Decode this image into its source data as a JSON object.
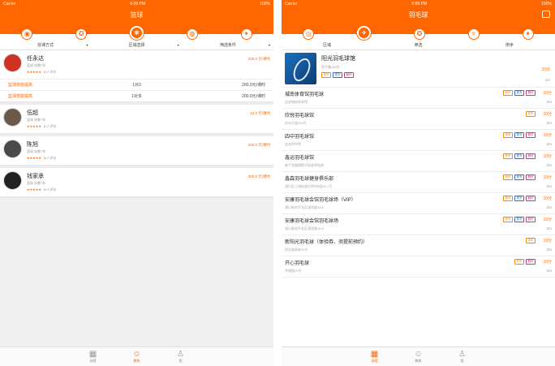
{
  "left": {
    "status": {
      "carrier": "Carrier",
      "time": "6:09 PM",
      "battery": "100%"
    },
    "title": "篮球",
    "categories": [
      {
        "icon": "whistle-icon",
        "glyph": "◉",
        "active": false
      },
      {
        "icon": "soccer-icon",
        "glyph": "✪",
        "active": false
      },
      {
        "icon": "basketball-icon",
        "glyph": "❋",
        "active": true
      },
      {
        "icon": "volleyball-icon",
        "glyph": "◍",
        "active": false
      },
      {
        "icon": "runner-icon",
        "glyph": "✦",
        "active": false
      }
    ],
    "filters": [
      "授课方式",
      "区域选择",
      "筛选条件"
    ],
    "coaches": [
      {
        "name": "任永达",
        "sub": "篮球 执教7年",
        "stars": "★★★★★",
        "reviews": "10人评价",
        "price": "200.0 元/课时",
        "avatar_color": "#cc3322",
        "courses": [
          {
            "name": "篮球技能提高",
            "type": "1对3",
            "price": "200.0元/课时"
          },
          {
            "name": "篮球技能提高",
            "type": "1对多",
            "price": "200.0元/课时"
          }
        ]
      },
      {
        "name": "伍超",
        "sub": "篮球 执教7年",
        "stars": "★★★★★",
        "reviews": "10人评价",
        "price": "10.0 元/课时",
        "avatar_color": "#6b5a4a",
        "courses": []
      },
      {
        "name": "陈旭",
        "sub": "篮球 执教7年",
        "stars": "★★★★★",
        "reviews": "10人评价",
        "price": "200.0 元/课时",
        "avatar_color": "#4a4a4a",
        "courses": []
      },
      {
        "name": "钱家承",
        "sub": "篮球 执教7年",
        "stars": "★★★★★",
        "reviews": "10人评价",
        "price": "300.0 元/课时",
        "avatar_color": "#222222",
        "courses": []
      }
    ],
    "tabs": [
      {
        "label": "场馆",
        "icon": "grid-icon",
        "glyph": "▦",
        "active": false
      },
      {
        "label": "教练",
        "icon": "users-icon",
        "glyph": "☺",
        "active": true
      },
      {
        "label": "我",
        "icon": "person-icon",
        "glyph": "♙",
        "active": false
      }
    ]
  },
  "right": {
    "status": {
      "carrier": "Carrier",
      "time": "6:09 PM",
      "battery": "100%"
    },
    "title": "羽毛球",
    "categories": [
      {
        "icon": "target-icon",
        "glyph": "◎",
        "active": false
      },
      {
        "icon": "badminton-icon",
        "glyph": "✈",
        "active": true
      },
      {
        "icon": "soccer-icon",
        "glyph": "✪",
        "active": false
      },
      {
        "icon": "swimming-icon",
        "glyph": "≈",
        "active": false
      },
      {
        "icon": "runner-icon",
        "glyph": "✦",
        "active": false
      }
    ],
    "filters": [
      "区域",
      "筛选",
      "排序"
    ],
    "featured": {
      "name": "阳光羽毛球馆",
      "addr": "华宁路190号",
      "tags": [
        {
          "text": "停车",
          "cls": "t-or"
        },
        {
          "text": "更衣",
          "cls": "t-bl"
        },
        {
          "text": "器材",
          "cls": "t-pk"
        }
      ],
      "score": "10分",
      "dist": "1m"
    },
    "venues": [
      {
        "name": "城南体育馆羽毛球",
        "addr": "连安城南体育馆",
        "tags": [
          {
            "text": "停车",
            "cls": "t-or"
          },
          {
            "text": "更衣",
            "cls": "t-bl"
          },
          {
            "text": "器材",
            "cls": "t-pk"
          }
        ],
        "score": "10分",
        "dist": "2m"
      },
      {
        "name": "欣悦羽毛球馆",
        "addr": "苏州大道259号",
        "tags": [
          {
            "text": "停车",
            "cls": "t-or"
          }
        ],
        "score": "10分",
        "dist": "2m"
      },
      {
        "name": "四中羽毛球馆",
        "addr": "连安四中馆",
        "tags": [
          {
            "text": "停车",
            "cls": "t-or"
          },
          {
            "text": "更衣",
            "cls": "t-bl"
          },
          {
            "text": "器材",
            "cls": "t-pk"
          }
        ],
        "score": "10分",
        "dist": "2m"
      },
      {
        "name": "鑫运羽毛球馆",
        "addr": "新千里路隔壁对面老师电商",
        "tags": [
          {
            "text": "停车",
            "cls": "t-or"
          },
          {
            "text": "更衣",
            "cls": "t-bl"
          },
          {
            "text": "器材",
            "cls": "t-pk"
          }
        ],
        "score": "10分",
        "dist": "2m"
      },
      {
        "name": "鑫森羽毛球健身俱乐部",
        "addr": "浦口区江浦街道光明村8组68-1号",
        "tags": [
          {
            "text": "停车",
            "cls": "t-or"
          },
          {
            "text": "更衣",
            "cls": "t-bl"
          },
          {
            "text": "器材",
            "cls": "t-pk"
          }
        ],
        "score": "10分",
        "dist": "2m"
      },
      {
        "name": "安康羽毛球会馆羽毛球场（VIP）",
        "addr": "浦口新房开发区浦滨路16-5",
        "tags": [
          {
            "text": "停车",
            "cls": "t-or"
          },
          {
            "text": "更衣",
            "cls": "t-bl"
          },
          {
            "text": "器材",
            "cls": "t-pk"
          }
        ],
        "score": "10分",
        "dist": "2m"
      },
      {
        "name": "安康羽毛球会馆羽毛球场",
        "addr": "浦口新房开发区浦滨路16-5",
        "tags": [
          {
            "text": "停车",
            "cls": "t-or"
          },
          {
            "text": "更衣",
            "cls": "t-bl"
          },
          {
            "text": "器材",
            "cls": "t-pk"
          }
        ],
        "score": "10分",
        "dist": "2m"
      },
      {
        "name": "新阳光羽毛球（体验券、须提前预约）",
        "addr": "桥北路高新20号",
        "tags": [
          {
            "text": "停车",
            "cls": "t-or"
          }
        ],
        "score": "10分",
        "dist": "2m"
      },
      {
        "name": "开心羽毛球",
        "addr": "幸福路20号",
        "tags": [
          {
            "text": "停车",
            "cls": "t-or"
          },
          {
            "text": "器材",
            "cls": "t-pk"
          }
        ],
        "score": "10分",
        "dist": "2m"
      }
    ],
    "tabs": [
      {
        "label": "场馆",
        "icon": "grid-icon",
        "glyph": "▦",
        "active": true
      },
      {
        "label": "教练",
        "icon": "users-icon",
        "glyph": "☺",
        "active": false
      },
      {
        "label": "我",
        "icon": "person-icon",
        "glyph": "♙",
        "active": false
      }
    ]
  }
}
